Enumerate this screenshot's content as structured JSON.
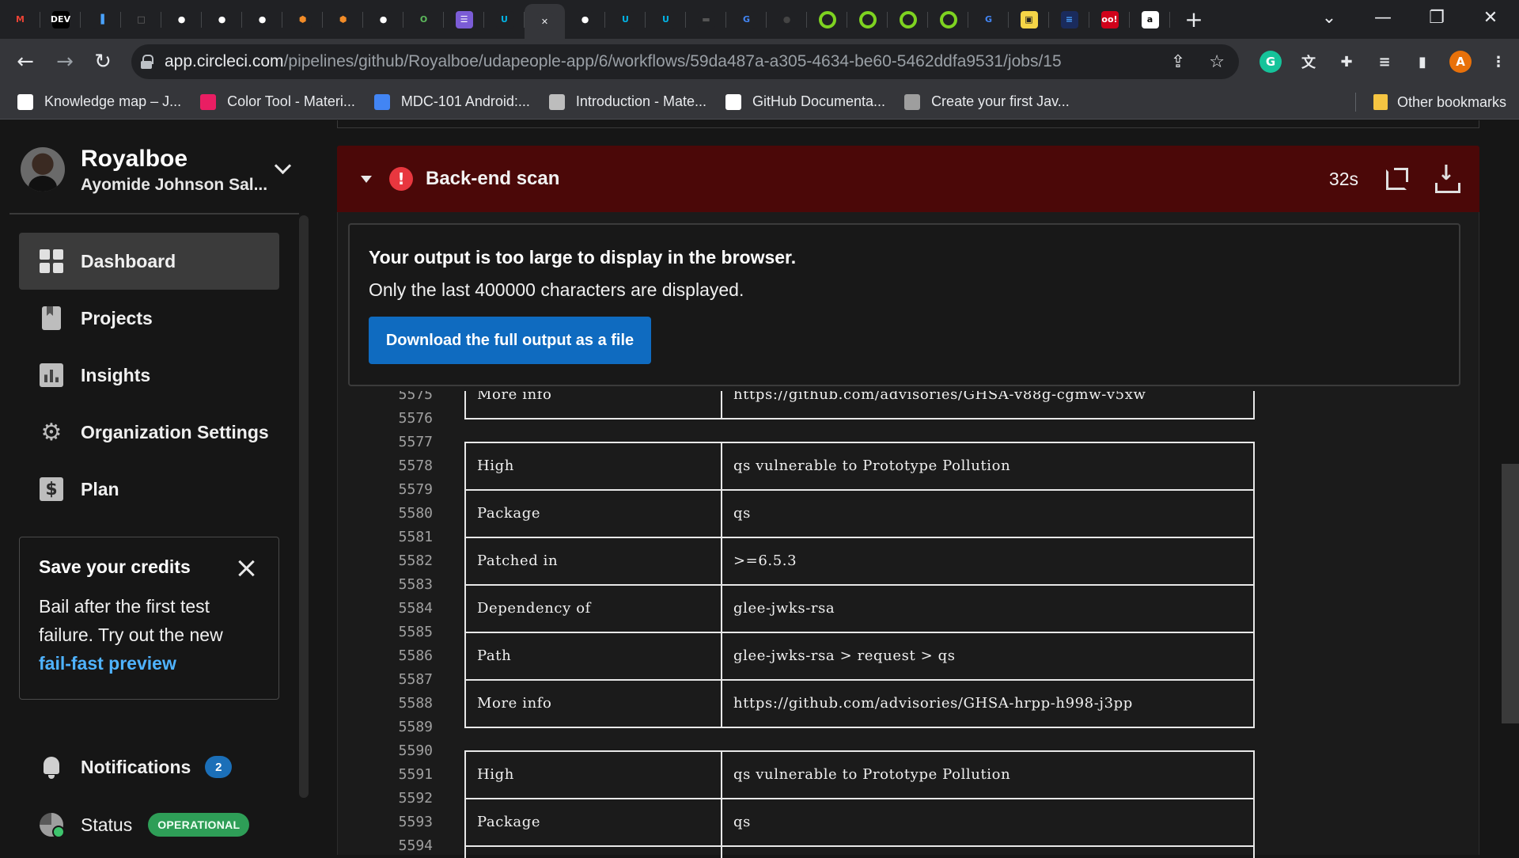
{
  "browser": {
    "tabs": [
      {
        "name": "gmail-tab",
        "glyph": "M",
        "color": "#ea4335",
        "bg": "#202124"
      },
      {
        "name": "dev-tab",
        "glyph": "DEV",
        "color": "#ffffff",
        "bg": "#000000"
      },
      {
        "name": "stats-tab",
        "glyph": "▐",
        "color": "#4aa3ff",
        "bg": "#202124"
      },
      {
        "name": "blank-tab",
        "glyph": "□",
        "color": "#6b6b6b",
        "bg": "#202124"
      },
      {
        "name": "github-tab-1",
        "glyph": "●",
        "color": "#ffffff",
        "bg": "#202124"
      },
      {
        "name": "github-tab-2",
        "glyph": "●",
        "color": "#ffffff",
        "bg": "#202124"
      },
      {
        "name": "github-tab-3",
        "glyph": "●",
        "color": "#ffffff",
        "bg": "#202124"
      },
      {
        "name": "cube-tab-1",
        "glyph": "⬢",
        "color": "#f28c28",
        "bg": "#202124"
      },
      {
        "name": "cube-tab-2",
        "glyph": "⬢",
        "color": "#f28c28",
        "bg": "#202124"
      },
      {
        "name": "github-tab-4",
        "glyph": "●",
        "color": "#ffffff",
        "bg": "#202124"
      },
      {
        "name": "o-tab",
        "glyph": "O",
        "color": "#5cb85c",
        "bg": "#202124"
      },
      {
        "name": "notes-tab",
        "glyph": "☰",
        "color": "#ffffff",
        "bg": "#7b5cd6"
      },
      {
        "name": "udacity-tab-1",
        "glyph": "U",
        "color": "#02b3e4",
        "bg": "#202124"
      },
      {
        "name": "circleci-tab-active",
        "glyph": "✕",
        "color": "#e8eaed",
        "bg": "#35363a"
      },
      {
        "name": "github-tab-5",
        "glyph": "●",
        "color": "#ffffff",
        "bg": "#202124"
      },
      {
        "name": "udacity-tab-2",
        "glyph": "U",
        "color": "#02b3e4",
        "bg": "#202124"
      },
      {
        "name": "udacity-tab-3",
        "glyph": "U",
        "color": "#02b3e4",
        "bg": "#202124"
      },
      {
        "name": "folder-tab",
        "glyph": "▬",
        "color": "#555555",
        "bg": "#202124"
      },
      {
        "name": "google-tab-1",
        "glyph": "G",
        "color": "#4285f4",
        "bg": "#202124"
      },
      {
        "name": "dim-tab",
        "glyph": "●",
        "color": "#444444",
        "bg": "#202124"
      },
      {
        "name": "ring-tab-1",
        "glyph": "ring",
        "color": "#7ed321",
        "bg": "#202124"
      },
      {
        "name": "ring-tab-2",
        "glyph": "ring",
        "color": "#7ed321",
        "bg": "#202124"
      },
      {
        "name": "ring-tab-3",
        "glyph": "ring",
        "color": "#7ed321",
        "bg": "#202124"
      },
      {
        "name": "ring-tab-4",
        "glyph": "ring",
        "color": "#7ed321",
        "bg": "#202124"
      },
      {
        "name": "google-tab-2",
        "glyph": "G",
        "color": "#4285f4",
        "bg": "#202124"
      },
      {
        "name": "yellow-tab",
        "glyph": "▣",
        "color": "#222222",
        "bg": "#f5d547"
      },
      {
        "name": "blue-tab",
        "glyph": "≡",
        "color": "#4aa3ff",
        "bg": "#1a2b5c"
      },
      {
        "name": "oo-tab",
        "glyph": "oo!",
        "color": "#ffffff",
        "bg": "#d0021b"
      },
      {
        "name": "amazon-tab",
        "glyph": "a",
        "color": "#000000",
        "bg": "#ffffff"
      }
    ],
    "url_host": "app.circleci.com",
    "url_path": "/pipelines/github/Royalboe/udapeople-app/6/workflows/59da487a-a305-4634-be60-5462ddfa9531/jobs/15",
    "profile_initial": "A",
    "bookmarks": [
      {
        "label": "Knowledge map – J...",
        "color": "#ffffff",
        "name": "bookmark-knowledge-map"
      },
      {
        "label": "Color Tool - Materi...",
        "color": "#e91e63",
        "name": "bookmark-color-tool"
      },
      {
        "label": "MDC-101 Android:...",
        "color": "#4285f4",
        "name": "bookmark-mdc-101"
      },
      {
        "label": "Introduction - Mate...",
        "color": "#bdbdbd",
        "name": "bookmark-introduction"
      },
      {
        "label": "GitHub Documenta...",
        "color": "#ffffff",
        "name": "bookmark-github-docs"
      },
      {
        "label": "Create your first Jav...",
        "color": "#9e9e9e",
        "name": "bookmark-create-java"
      }
    ],
    "other_bookmarks": "Other bookmarks"
  },
  "sidebar": {
    "user_name": "Royalboe",
    "org_name": "Ayomide Johnson Sal...",
    "nav": [
      {
        "label": "Dashboard",
        "icon": "dashboard-icon",
        "active": true
      },
      {
        "label": "Projects",
        "icon": "projects-icon",
        "active": false
      },
      {
        "label": "Insights",
        "icon": "insights-icon",
        "active": false
      },
      {
        "label": "Organization Settings",
        "icon": "gear-icon",
        "active": false
      },
      {
        "label": "Plan",
        "icon": "plan-icon",
        "active": false
      }
    ],
    "promo": {
      "title": "Save your credits",
      "body": "Bail after the first test failure. Try out the new",
      "link": "fail-fast preview"
    },
    "notifications_label": "Notifications",
    "notifications_count": "2",
    "status_label": "Status",
    "status_value": "OPERATIONAL"
  },
  "job": {
    "title": "Back-end scan",
    "duration": "32s",
    "warning_title": "Your output is too large to display in the browser.",
    "warning_text": "Only the last 400000 characters are displayed.",
    "download_label": "Download the full output as a file",
    "log": [
      {
        "n": "5575",
        "kind": "row",
        "c1": "More info",
        "c2": "https://github.com/advisories/GHSA-v88g-cgmw-v5xw"
      },
      {
        "n": "5576",
        "kind": "bottom"
      },
      {
        "n": "5577",
        "kind": "top"
      },
      {
        "n": "5578",
        "kind": "row",
        "c1": "High",
        "c2": "qs vulnerable to Prototype Pollution"
      },
      {
        "n": "5579",
        "kind": "sep"
      },
      {
        "n": "5580",
        "kind": "row",
        "c1": "Package",
        "c2": "qs"
      },
      {
        "n": "5581",
        "kind": "sep"
      },
      {
        "n": "5582",
        "kind": "row",
        "c1": "Patched in",
        "c2": ">=6.5.3"
      },
      {
        "n": "5583",
        "kind": "sep"
      },
      {
        "n": "5584",
        "kind": "row",
        "c1": "Dependency of",
        "c2": "glee-jwks-rsa"
      },
      {
        "n": "5585",
        "kind": "sep"
      },
      {
        "n": "5586",
        "kind": "row",
        "c1": "Path",
        "c2": "glee-jwks-rsa > request > qs"
      },
      {
        "n": "5587",
        "kind": "sep"
      },
      {
        "n": "5588",
        "kind": "row",
        "c1": "More info",
        "c2": "https://github.com/advisories/GHSA-hrpp-h998-j3pp"
      },
      {
        "n": "5589",
        "kind": "bottom"
      },
      {
        "n": "5590",
        "kind": "top"
      },
      {
        "n": "5591",
        "kind": "row",
        "c1": "High",
        "c2": "qs vulnerable to Prototype Pollution"
      },
      {
        "n": "5592",
        "kind": "sep"
      },
      {
        "n": "5593",
        "kind": "row",
        "c1": "Package",
        "c2": "qs"
      },
      {
        "n": "5594",
        "kind": "sep"
      }
    ]
  }
}
